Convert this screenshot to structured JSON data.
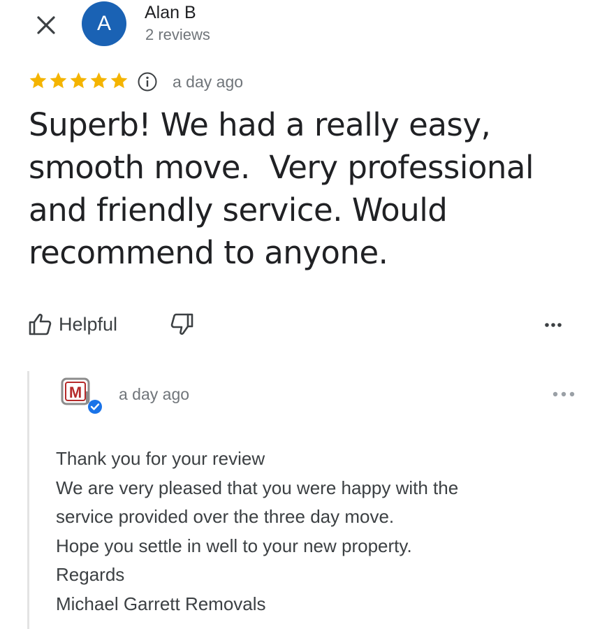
{
  "reviewer": {
    "avatar_letter": "A",
    "avatar_color": "#1a62b4",
    "name": "Alan B",
    "review_count": "2 reviews"
  },
  "rating": {
    "stars": 5,
    "star_color": "#f4b400",
    "time": "a day ago"
  },
  "review": {
    "text": "Superb! We had a really easy,\nsmooth move.  Very professional\nand friendly service. Would\nrecommend to anyone."
  },
  "actions": {
    "helpful_label": "Helpful",
    "helpful_icon": "thumbs-up-icon",
    "dislike_icon": "thumbs-down-icon",
    "more_icon": "more-horizontal-icon"
  },
  "owner_reply": {
    "logo_letter": "M",
    "logo_color": "#b52a2a",
    "verified_color": "#1a73e8",
    "time": "a day ago",
    "lines": [
      "Thank you for your review",
      "We are very pleased that you were happy with the",
      "service provided over the three day move.",
      "Hope you settle in well to your new property.",
      "Regards",
      "Michael Garrett Removals"
    ]
  }
}
